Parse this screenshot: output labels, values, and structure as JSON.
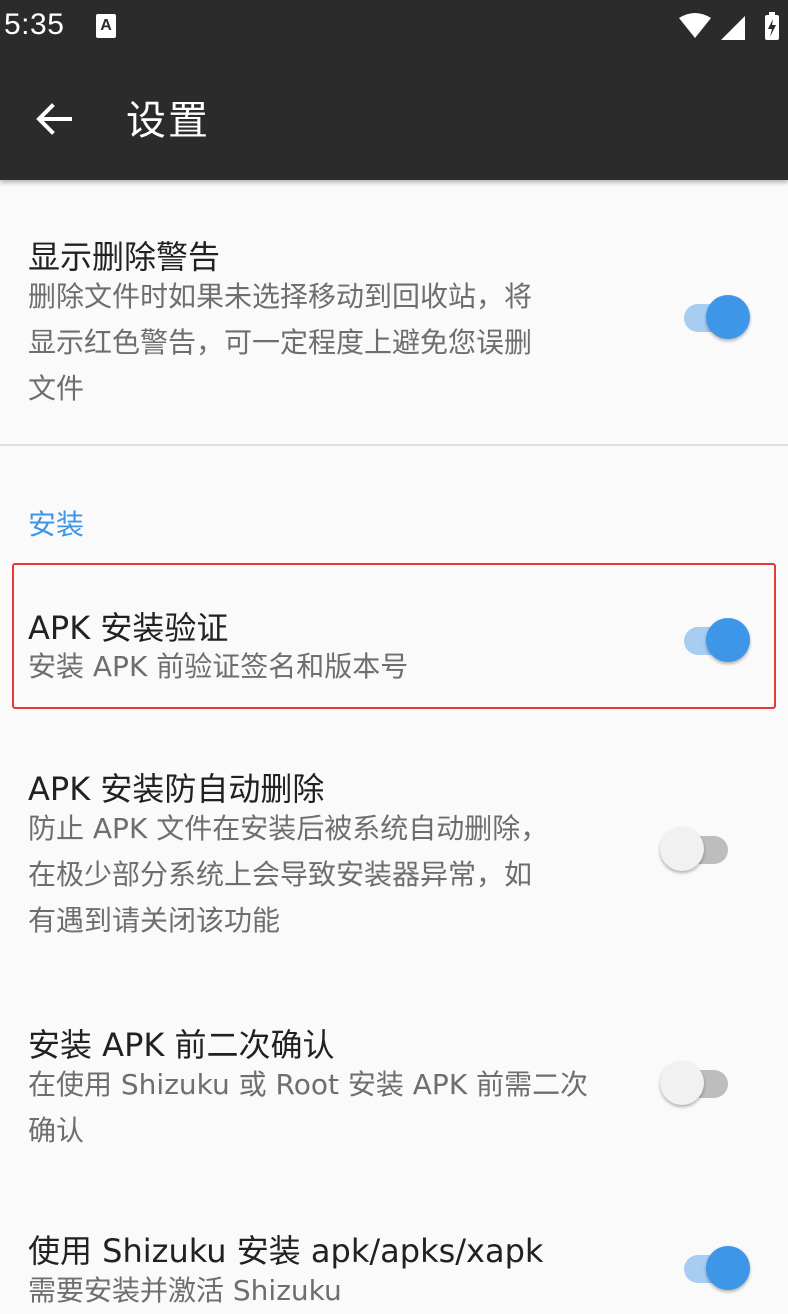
{
  "status_bar": {
    "time": "5:35",
    "notification_glyph": "A",
    "icons": [
      "wifi-icon",
      "signal-icon",
      "battery-charging-icon"
    ]
  },
  "app_bar": {
    "title": "设置",
    "back_icon": "arrow-left-icon"
  },
  "prefs": [
    {
      "title": "显示删除警告",
      "summary_lines": [
        "删除文件时如果未选择移动到回收站，将",
        "显示红色警告，可一定程度上避免您误删",
        "文件"
      ],
      "enabled": true
    },
    {
      "title": "APK 安装验证",
      "summary_lines": [
        "安装 APK 前验证签名和版本号"
      ],
      "enabled": true
    },
    {
      "title": "APK 安装防自动删除",
      "summary_lines": [
        "防止 APK 文件在安装后被系统自动删除，",
        "在极少部分系统上会导致安装器异常，如",
        "有遇到请关闭该功能"
      ],
      "enabled": false
    },
    {
      "title": "安装 APK 前二次确认",
      "summary_lines": [
        "在使用 Shizuku 或 Root 安装 APK 前需二次",
        "确认"
      ],
      "enabled": false
    },
    {
      "title": "使用 Shizuku 安装 apk/apks/xapk",
      "summary_lines": [
        "需要安装并激活 Shizuku"
      ],
      "enabled": true
    }
  ],
  "category": {
    "label": "安装"
  },
  "colors": {
    "accent": "#3d96e8",
    "highlight": "#e53935",
    "bar": "#2b2b2b"
  }
}
